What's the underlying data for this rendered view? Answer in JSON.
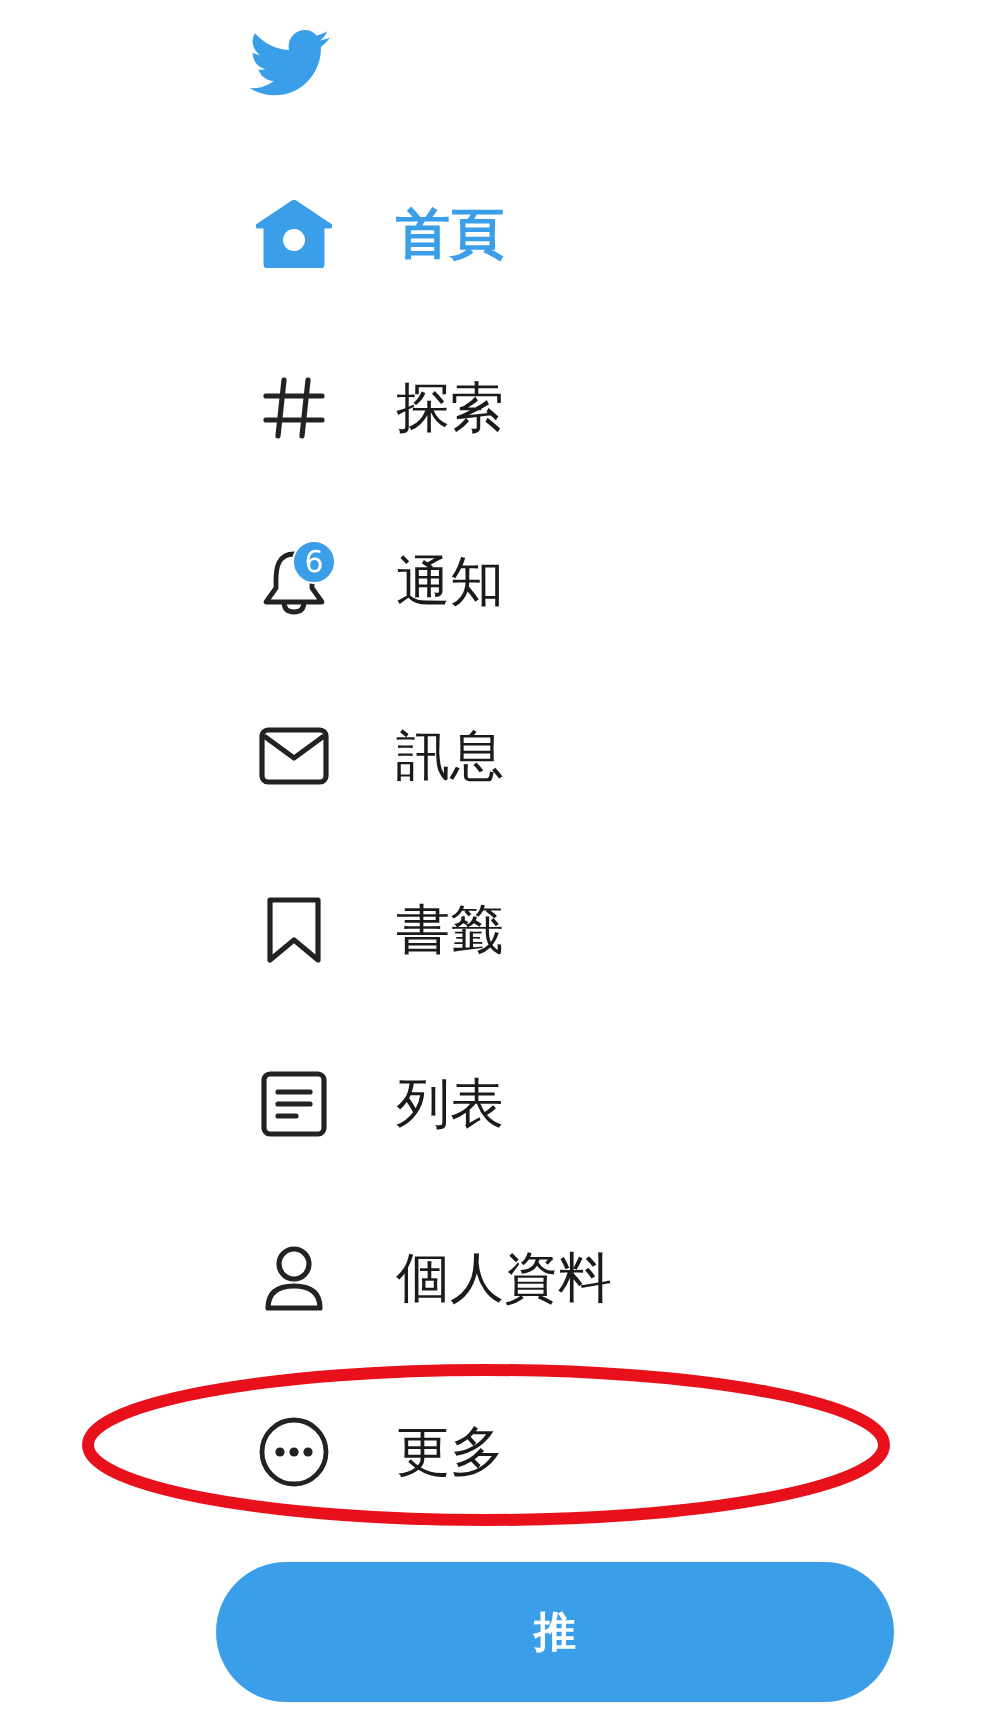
{
  "nav": {
    "items": [
      {
        "kind": "home",
        "label": "首頁",
        "selected": true,
        "highlighted": false
      },
      {
        "kind": "explore",
        "label": "探索",
        "selected": false,
        "highlighted": false
      },
      {
        "kind": "notifications",
        "label": "通知",
        "selected": false,
        "highlighted": false,
        "badge": "6"
      },
      {
        "kind": "messages",
        "label": "訊息",
        "selected": false,
        "highlighted": false
      },
      {
        "kind": "bookmarks",
        "label": "書籤",
        "selected": false,
        "highlighted": false
      },
      {
        "kind": "lists",
        "label": "列表",
        "selected": false,
        "highlighted": false
      },
      {
        "kind": "profile",
        "label": "個人資料",
        "selected": false,
        "highlighted": false
      },
      {
        "kind": "more",
        "label": "更多",
        "selected": false,
        "highlighted": true
      }
    ]
  },
  "tweet_button": {
    "label": "推"
  }
}
